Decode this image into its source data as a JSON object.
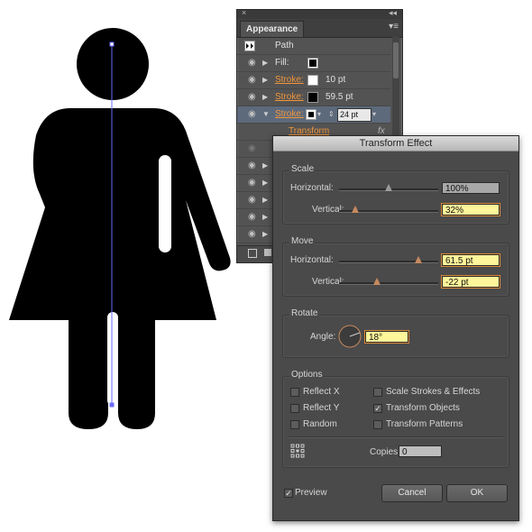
{
  "appearance_panel": {
    "close_glyph": "×",
    "collapse_glyph": "◂◂",
    "tab_label": "Appearance",
    "menu_glyph": "▾≡",
    "rows": [
      {
        "label": "Path",
        "value": ""
      },
      {
        "label": "Fill:",
        "value": ""
      },
      {
        "label": "Stroke:",
        "value": "10 pt"
      },
      {
        "label": "Stroke:",
        "value": "59.5 pt"
      },
      {
        "label": "Stroke:",
        "value": "24 pt"
      },
      {
        "label": "Transform",
        "value": "fx"
      }
    ]
  },
  "dialog": {
    "title": "Transform Effect",
    "scale": {
      "title": "Scale",
      "horizontal_label": "Horizontal:",
      "horizontal_value": "100%",
      "horizontal_level": 0.5,
      "vertical_label": "Vertical:",
      "vertical_value": "32%",
      "vertical_level": 0.16
    },
    "move": {
      "title": "Move",
      "horizontal_label": "Horizontal:",
      "horizontal_value": "61.5 pt",
      "horizontal_level": 0.8,
      "vertical_label": "Vertical:",
      "vertical_value": "-22 pt",
      "vertical_level": 0.38
    },
    "rotate": {
      "title": "Rotate",
      "angle_label": "Angle:",
      "angle_value": "18°"
    },
    "options": {
      "title": "Options",
      "reflect_x": "Reflect X",
      "reflect_y": "Reflect Y",
      "random": "Random",
      "scale_strokes": "Scale Strokes & Effects",
      "transform_objects": "Transform Objects",
      "transform_patterns": "Transform Patterns",
      "copies_label": "Copies",
      "copies_value": "0"
    },
    "preview_label": "Preview",
    "cancel_label": "Cancel",
    "ok_label": "OK"
  },
  "colors": {
    "panel_bg": "#535353",
    "dialog_bg": "#4a4a4a",
    "accent_orange": "#f0953a",
    "highlight_field": "#fff59a",
    "selection_blue": "#6b6bff"
  }
}
